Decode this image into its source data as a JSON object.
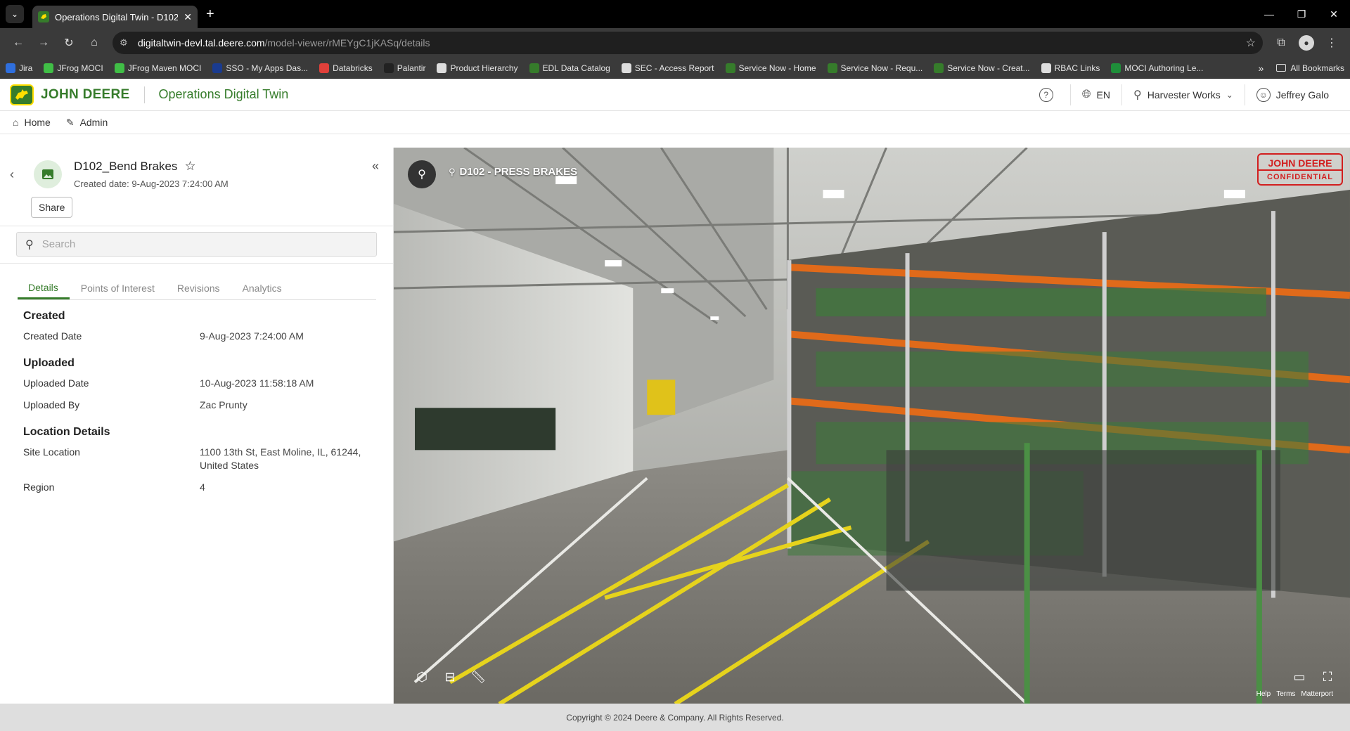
{
  "browser": {
    "tab_title": "Operations Digital Twin - D102",
    "url_host": "digitaltwin-devl.tal.deere.com",
    "url_path": "/model-viewer/rMEYgC1jKASq/details",
    "bookmarks": [
      {
        "label": "Jira",
        "color": "#2f6fde"
      },
      {
        "label": "JFrog MOCI",
        "color": "#40be46"
      },
      {
        "label": "JFrog Maven MOCI",
        "color": "#40be46"
      },
      {
        "label": "SSO - My Apps Das...",
        "color": "#1a3b8f"
      },
      {
        "label": "Databricks",
        "color": "#e0403a"
      },
      {
        "label": "Palantir",
        "color": "#222222"
      },
      {
        "label": "Product Hierarchy",
        "color": "#dddddd"
      },
      {
        "label": "EDL Data Catalog",
        "color": "#367c2b"
      },
      {
        "label": "SEC - Access Report",
        "color": "#dddddd"
      },
      {
        "label": "Service Now - Home",
        "color": "#367c2b"
      },
      {
        "label": "Service Now - Requ...",
        "color": "#367c2b"
      },
      {
        "label": "Service Now - Creat...",
        "color": "#367c2b"
      },
      {
        "label": "RBAC Links",
        "color": "#dddddd"
      },
      {
        "label": "MOCI Authoring Le...",
        "color": "#1f8f3a"
      }
    ],
    "bookmarks_more": "»",
    "all_bookmarks": "All Bookmarks"
  },
  "header": {
    "brand": "JOHN DEERE",
    "app_name": "Operations Digital Twin",
    "language": "EN",
    "site": "Harvester Works",
    "user": "Jeffrey Galo"
  },
  "subnav": {
    "home": "Home",
    "admin": "Admin"
  },
  "model": {
    "title": "D102_Bend Brakes",
    "created_line": "Created date: 9-Aug-2023 7:24:00 AM",
    "share_label": "Share"
  },
  "search": {
    "placeholder": "Search"
  },
  "tabs": [
    "Details",
    "Points of Interest",
    "Revisions",
    "Analytics"
  ],
  "details": {
    "created_title": "Created",
    "created_date_label": "Created Date",
    "created_date": "9-Aug-2023 7:24:00 AM",
    "uploaded_title": "Uploaded",
    "uploaded_date_label": "Uploaded Date",
    "uploaded_date": "10-Aug-2023 11:58:18 AM",
    "uploaded_by_label": "Uploaded By",
    "uploaded_by": "Zac Prunty",
    "location_title": "Location Details",
    "site_location_label": "Site Location",
    "site_location_line1": "1100 13th St, East Moline, IL, 61244,",
    "site_location_line2": "United States",
    "region_label": "Region",
    "region": "4"
  },
  "viewer": {
    "location_label": "D102 - PRESS BRAKES",
    "stamp_line1": "JOHN DEERE",
    "stamp_line2": "CONFIDENTIAL",
    "help": "Help",
    "terms": "Terms",
    "matterport": "Matterport"
  },
  "footer": {
    "copyright": "Copyright © 2024 Deere & Company. All Rights Reserved."
  },
  "colors": {
    "brand_green": "#367c2b",
    "brand_yellow": "#ffde00",
    "stamp_red": "#d21e1e"
  }
}
